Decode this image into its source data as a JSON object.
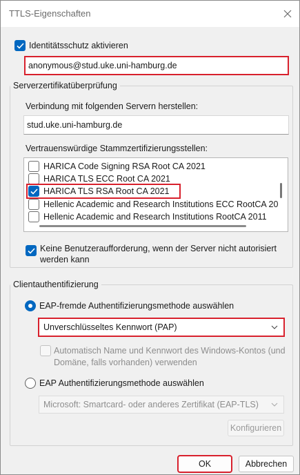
{
  "window": {
    "title": "TTLS-Eigenschaften",
    "accent_color": "#0067c0",
    "highlight_color": "#d8202c"
  },
  "identity": {
    "checkbox_label": "Identitätsschutz aktivieren",
    "checked": true,
    "value": "anonymous@stud.uke.uni-hamburg.de"
  },
  "server_validation": {
    "group_title": "Serverzertifikatüberprüfung",
    "connect_label": "Verbindung mit folgenden Servern herstellen:",
    "server_value": "stud.uke.uni-hamburg.de",
    "trusted_ca_label": "Vertrauenswürdige Stammzertifizierungsstellen:",
    "ca_list": [
      {
        "label": "HARICA Code Signing RSA Root CA 2021",
        "checked": false
      },
      {
        "label": "HARICA TLS ECC Root CA 2021",
        "checked": false
      },
      {
        "label": "HARICA TLS RSA Root CA 2021",
        "checked": true
      },
      {
        "label": "Hellenic Academic and Research Institutions ECC RootCA 20",
        "checked": false
      },
      {
        "label": "Hellenic Academic and Research Institutions RootCA 2011",
        "checked": false
      }
    ],
    "no_prompt_label_line1": "Keine Benutzeraufforderung, wenn der Server nicht autorisiert",
    "no_prompt_label_line2": "werden kann",
    "no_prompt_checked": true
  },
  "client_auth": {
    "group_title": "Clientauthentifizierung",
    "non_eap_label": "EAP-fremde Authentifizierungsmethode auswählen",
    "non_eap_selected": true,
    "non_eap_method": "Unverschlüsseltes Kennwort (PAP)",
    "auto_login_line1": "Automatisch Name und Kennwort des Windows-Kontos (und",
    "auto_login_line2": "Domäne, falls vorhanden) verwenden",
    "eap_label": "EAP Authentifizierungsmethode auswählen",
    "eap_method": "Microsoft: Smartcard- oder anderes Zertifikat (EAP-TLS)",
    "configure_label": "Konfigurieren"
  },
  "footer": {
    "ok_label": "OK",
    "cancel_label": "Abbrechen"
  }
}
